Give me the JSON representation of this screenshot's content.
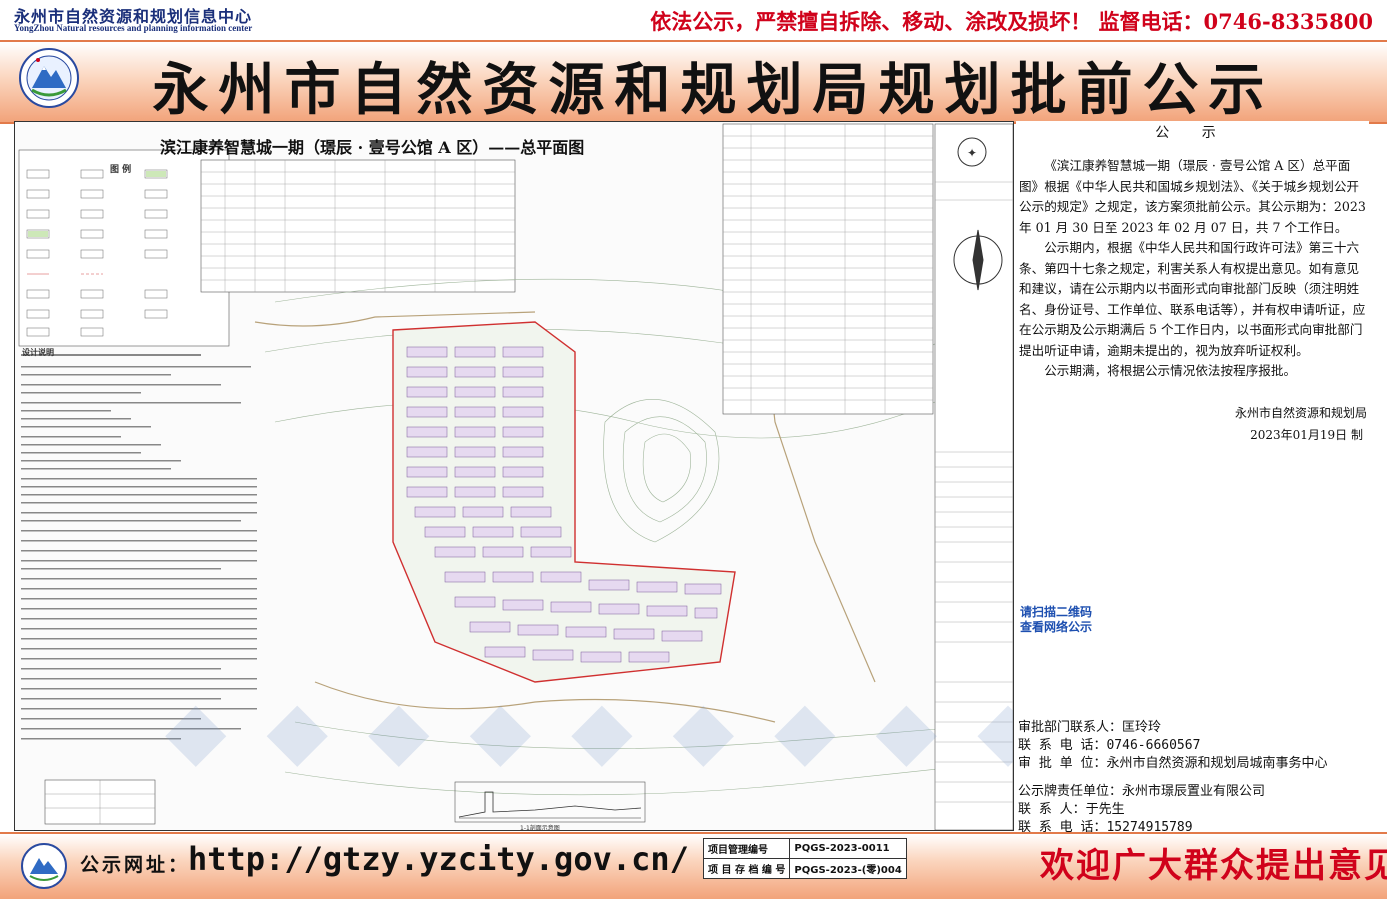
{
  "header": {
    "org_cn": "永州市自然资源和规划信息中心",
    "org_en": "YongZhou Natural resources and planning information center",
    "warning": "依法公示，严禁擅自拆除、移动、涂改及损坏！ 监督电话：0746-8335800",
    "main_title": "永州市自然资源和规划局规划批前公示"
  },
  "drawing": {
    "title": "滨江康养智慧城一期（璟辰 · 壹号公馆 A 区）——总平面图",
    "legend_title": "图 例",
    "design_notes_title": "设计说明",
    "qr_hint_1": "请扫描二维码",
    "qr_hint_2": "查看网络公示",
    "section_label": "1-1剖面示意图"
  },
  "notice": {
    "heading": "公 示",
    "paragraphs": [
      "《滨江康养智慧城一期（璟辰 · 壹号公馆 A 区）总平面图》根据《中华人民共和国城乡规划法》、《关于城乡规划公开公示的规定》之规定，该方案须批前公示。其公示期为：2023 年 01 月 30 日至 2023 年 02 月 07 日，共 7 个工作日。",
      "公示期内，根据《中华人民共和国行政许可法》第三十六条、第四十七条之规定，利害关系人有权提出意见。如有意见和建议，请在公示期内以书面形式向审批部门反映（须注明姓名、身份证号、工作单位、联系电话等），并有权申请听证，应在公示期及公示期满后 5 个工作日内，以书面形式向审批部门提出听证申请，逾期未提出的，视为放弃听证权利。",
      "公示期满，将根据公示情况依法按程序报批。"
    ],
    "issuer": "永州市自然资源和规划局",
    "date": "2023年01月19日  制",
    "contacts": [
      "审批部门联系人：匡玲玲",
      "联  系  电  话：0746-6660567",
      "审  批  单  位：永州市自然资源和规划局城南事务中心",
      "公示牌责任单位：永州市璟辰置业有限公司",
      "联     系    人：于先生",
      "联  系  电  话：15274915789"
    ]
  },
  "footer": {
    "web_label": "公示网址：",
    "web_url": "http://gtzy.yzcity.gov.cn/",
    "project_code_label": "项目管理编号",
    "project_code": "PQGS-2023-0011",
    "archive_label": "项 目 存 档 编 号",
    "archive_code": "PQGS-2023-(零)004",
    "welcome": "欢迎广大群众提出意见"
  },
  "colors": {
    "accent_red": "#d0021b",
    "banner_orange": "#f2a37a",
    "org_blue": "#1a2f7a"
  }
}
